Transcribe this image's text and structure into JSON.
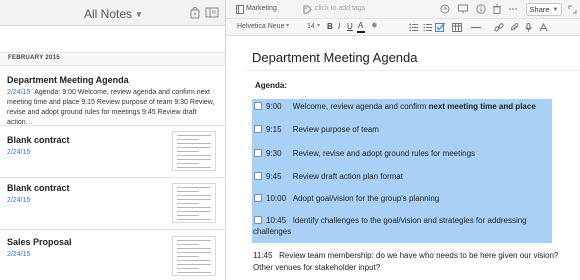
{
  "note_list": {
    "title": "All Notes",
    "section_label": "FEBRUARY 2015",
    "notes": [
      {
        "title": "Department Meeting Agenda",
        "date": "2/24/15",
        "snippet": "Agenda: 9:00 Welcome, review agenda and confirm next meeting time and place 9:15 Review purpose of team 9:30 Review, revise and adopt ground rules for meetings 9:45 Review draft action…"
      },
      {
        "title": "Blank contract",
        "date": "2/24/15"
      },
      {
        "title": "Blank contract",
        "date": "2/24/15"
      },
      {
        "title": "Sales Proposal",
        "date": "2/24/15"
      }
    ]
  },
  "editor": {
    "notebook": "Marketing",
    "tags_placeholder": "click to add tags",
    "share_label": "Share",
    "font_family": "Helvetica Neue",
    "font_size": "14",
    "doc_title": "Department Meeting Agenda",
    "agenda_label": "Agenda:",
    "items": [
      {
        "time": "9:00",
        "text": "Welcome, review agenda and confirm ",
        "bold": "next meeting time and place"
      },
      {
        "time": "9:15",
        "text": "Review purpose of team"
      },
      {
        "time": "9:30",
        "text": "Review, revise and adopt ground rules for meetings"
      },
      {
        "time": "9:45",
        "text": "Review draft action plan format"
      },
      {
        "time": "10:00",
        "text": "Adopt goal/vision for the group's planning"
      },
      {
        "time": "10:45",
        "text": "Identify challenges to the goal/vision and strategies for addressing",
        "continuation": "challenges"
      }
    ],
    "item7": {
      "time": "11:45",
      "text": "Review team membership: do we have who needs to be here given our vision?",
      "line2": "Other venues for stakeholder input?"
    },
    "selection_color": "#a9d0f5"
  }
}
